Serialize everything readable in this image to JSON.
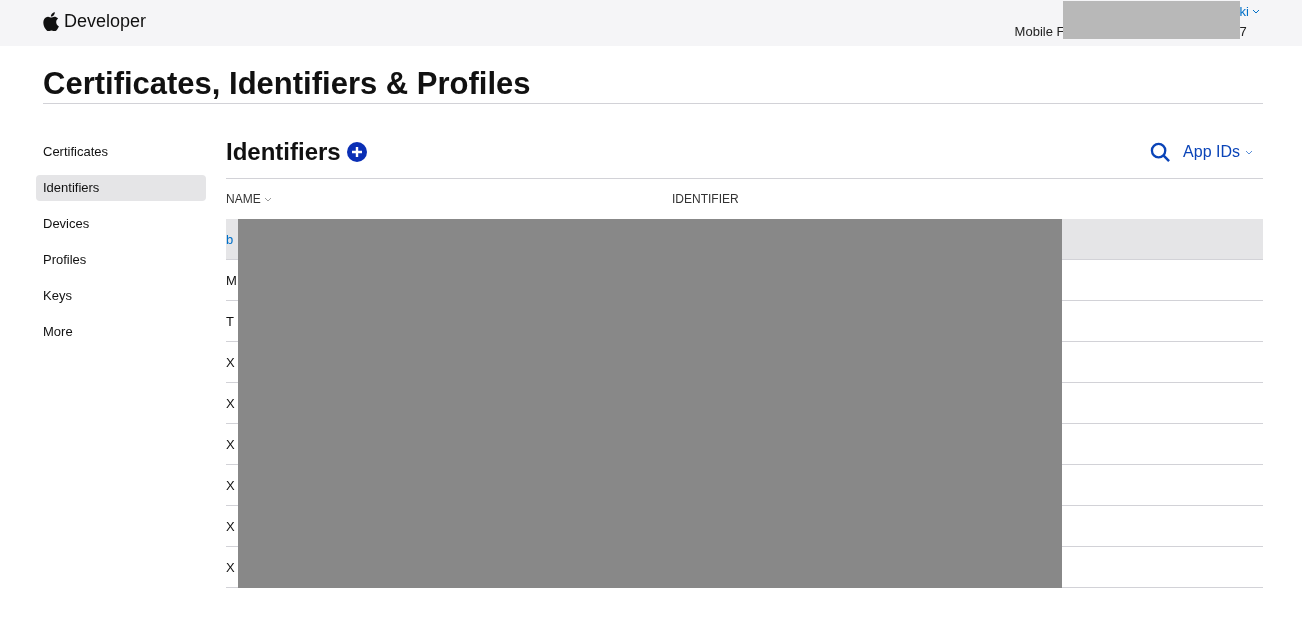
{
  "header": {
    "brand": "Developer",
    "account_name": "ki",
    "account_team_start": "Mobile F",
    "account_team_end": "7"
  },
  "page_title": "Certificates, Identifiers & Profiles",
  "sidebar": {
    "items": [
      {
        "label": "Certificates",
        "selected": false
      },
      {
        "label": "Identifiers",
        "selected": true
      },
      {
        "label": "Devices",
        "selected": false
      },
      {
        "label": "Profiles",
        "selected": false
      },
      {
        "label": "Keys",
        "selected": false
      },
      {
        "label": "More",
        "selected": false
      }
    ]
  },
  "section": {
    "title": "Identifiers",
    "filter": "App IDs"
  },
  "table": {
    "columns": [
      "NAME",
      "IDENTIFIER"
    ],
    "rows": [
      {
        "name": "b",
        "selected": true
      },
      {
        "name": "M",
        "selected": false
      },
      {
        "name": "T",
        "selected": false
      },
      {
        "name": "X",
        "selected": false
      },
      {
        "name": "X",
        "selected": false
      },
      {
        "name": "X",
        "selected": false
      },
      {
        "name": "X",
        "selected": false
      },
      {
        "name": "X",
        "selected": false
      },
      {
        "name": "X",
        "selected": false
      }
    ]
  }
}
